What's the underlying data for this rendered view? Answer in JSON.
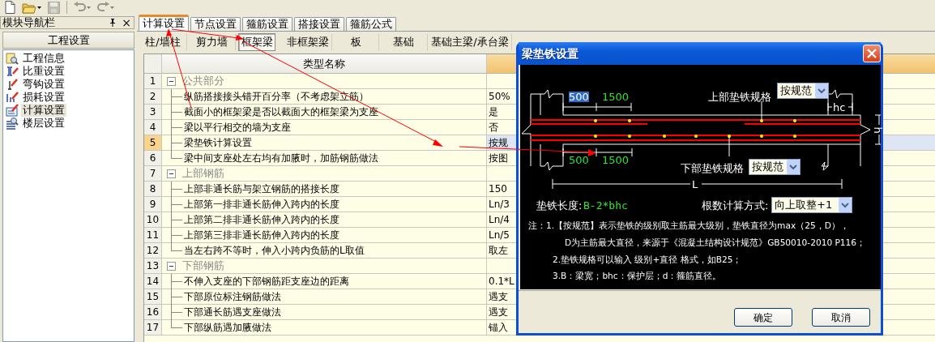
{
  "toolbar": [
    {
      "kind": "new",
      "disabled": false
    },
    {
      "kind": "open",
      "disabled": false,
      "dropdown": true
    },
    {
      "kind": "save",
      "disabled": true
    },
    {
      "kind": "undo",
      "disabled": true,
      "dropdown": true
    },
    {
      "kind": "redo",
      "disabled": true,
      "dropdown": true
    }
  ],
  "navigator": {
    "title": "模块导航栏",
    "close": "×",
    "section": "工程设置",
    "items": [
      {
        "label": "工程信息",
        "kind": "info",
        "selected": false
      },
      {
        "label": "比重设置",
        "kind": "weight",
        "selected": false
      },
      {
        "label": "弯钩设置",
        "kind": "hook",
        "selected": false
      },
      {
        "label": "损耗设置",
        "kind": "loss",
        "selected": false
      },
      {
        "label": "计算设置",
        "kind": "calc",
        "selected": true
      },
      {
        "label": "楼层设置",
        "kind": "floor",
        "selected": false
      }
    ]
  },
  "tabs": [
    {
      "label": "计算设置",
      "selected": true
    },
    {
      "label": "节点设置",
      "selected": false
    },
    {
      "label": "箍筋设置",
      "selected": false
    },
    {
      "label": "搭接设置",
      "selected": false
    },
    {
      "label": "箍筋公式",
      "selected": false
    }
  ],
  "categories": [
    {
      "label": "柱/墙柱",
      "selected": false
    },
    {
      "label": "剪力墙",
      "selected": false
    },
    {
      "label": "框架梁",
      "selected": true
    },
    {
      "label": "非框架梁",
      "selected": false
    },
    {
      "label": "板",
      "selected": false
    },
    {
      "label": "基础",
      "selected": false
    },
    {
      "label": "基础主梁/承台梁",
      "selected": false
    }
  ],
  "table": {
    "column": "类型名称",
    "rows": [
      {
        "number": "1",
        "kind": "group",
        "name": "公共部分",
        "expanded": true,
        "selected": false
      },
      {
        "number": "2",
        "kind": "item",
        "name": "纵筋搭接接头错开百分率（不考虑架立筋）",
        "value": "50%",
        "selected": false
      },
      {
        "number": "3",
        "kind": "item",
        "name": "截面小的框架梁是否以截面大的框架梁为支座",
        "value": "是",
        "selected": false
      },
      {
        "number": "4",
        "kind": "item",
        "name": "梁以平行相交的墙为支座",
        "value": "否",
        "selected": false
      },
      {
        "number": "5",
        "kind": "item",
        "name": "梁垫铁计算设置",
        "value": "按规",
        "selected": true
      },
      {
        "number": "6",
        "kind": "item",
        "name": "梁中间支座处左右均有加腋时，加筋钢筋做法",
        "value": "按图",
        "selected": false
      },
      {
        "number": "7",
        "kind": "group",
        "name": "上部钢筋",
        "expanded": true,
        "selected": false
      },
      {
        "number": "8",
        "kind": "item",
        "name": "上部非通长筋与架立钢筋的搭接长度",
        "value": "150",
        "selected": false
      },
      {
        "number": "9",
        "kind": "item",
        "name": "上部第一排非通长筋伸入跨内的长度",
        "value": "Ln/3",
        "selected": false
      },
      {
        "number": "10",
        "kind": "item",
        "name": "上部第二排非通长筋伸入跨内的长度",
        "value": "Ln/4",
        "selected": false
      },
      {
        "number": "11",
        "kind": "item",
        "name": "上部第三排非通长筋伸入跨内的长度",
        "value": "Ln/5",
        "selected": false
      },
      {
        "number": "12",
        "kind": "item",
        "name": "当左右跨不等时，伸入小跨内负筋的L取值",
        "value": "取左",
        "selected": false
      },
      {
        "number": "13",
        "kind": "group",
        "name": "下部钢筋",
        "expanded": true,
        "selected": false
      },
      {
        "number": "14",
        "kind": "item",
        "name": "不伸入支座的下部钢筋距支座边的距离",
        "value": "0.1*L",
        "selected": false
      },
      {
        "number": "15",
        "kind": "item",
        "name": "下部原位标注钢筋做法",
        "value": "遇支",
        "selected": false
      },
      {
        "number": "16",
        "kind": "item",
        "name": "下部通长筋遇支座做法",
        "value": "遇支",
        "selected": false
      },
      {
        "number": "17",
        "kind": "item",
        "name": "下部纵筋遇加腋做法",
        "value": "锚入",
        "selected": false
      }
    ]
  },
  "dialog": {
    "title": "梁垫铁设置",
    "top_spec": {
      "label": "上部垫铁规格",
      "value": "按规范"
    },
    "top_dims": [
      {
        "text": "500",
        "selected": true
      },
      {
        "text": "1500",
        "selected": false
      }
    ],
    "bottom_dims": [
      {
        "text": "500",
        "selected": false
      },
      {
        "text": "1500",
        "selected": false
      }
    ],
    "bottom_spec": {
      "label": "下部垫铁规格",
      "value": "按规范"
    },
    "hc_label": "hc",
    "h_label": "h",
    "l_label": "L",
    "length_label": "垫铁长度:",
    "length_formula": "B-2*bhc",
    "count_method": {
      "label": "根数计算方式:",
      "value": "向上取整+1"
    },
    "notes": [
      "注：1.【按规范】表示垫铁的级别取主筋最大级别，垫铁直径为max（25，D），",
      "D为主筋最大直径，来源于《混凝土结构设计规范》GB50010-2010 P116；",
      "2.垫铁规格可以输入 级别+直径 格式，如B25；",
      "3.B：梁宽；bhc：保护层；d：箍筋直径。"
    ],
    "buttons": [
      "确定",
      "取消"
    ]
  }
}
